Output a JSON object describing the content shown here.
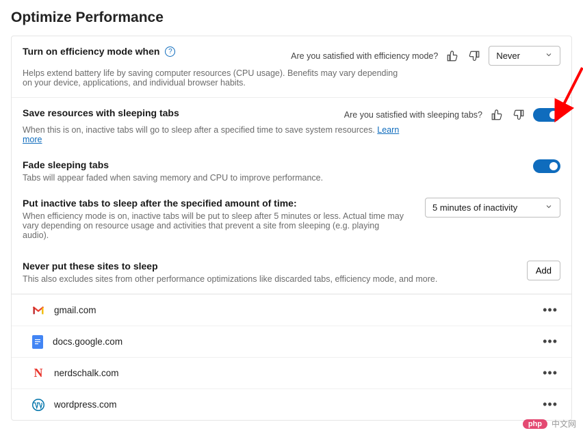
{
  "page_title": "Optimize Performance",
  "efficiency": {
    "title": "Turn on efficiency mode when",
    "desc": "Helps extend battery life by saving computer resources (CPU usage). Benefits may vary depending on your device, applications, and individual browser habits.",
    "feedback_q": "Are you satisfied with efficiency mode?",
    "select_value": "Never"
  },
  "sleeping": {
    "title": "Save resources with sleeping tabs",
    "desc_a": "When this is on, inactive tabs will go to sleep after a specified time to save system resources. ",
    "desc_link": "Learn more",
    "feedback_q": "Are you satisfied with sleeping tabs?",
    "toggle_on": true
  },
  "fade": {
    "title": "Fade sleeping tabs",
    "desc": "Tabs will appear faded when saving memory and CPU to improve performance.",
    "toggle_on": true
  },
  "timer": {
    "title": "Put inactive tabs to sleep after the specified amount of time:",
    "desc": "When efficiency mode is on, inactive tabs will be put to sleep after 5 minutes or less. Actual time may vary depending on resource usage and activities that prevent a site from sleeping (e.g. playing audio).",
    "select_value": "5 minutes of inactivity"
  },
  "never_sleep": {
    "title": "Never put these sites to sleep",
    "desc": "This also excludes sites from other performance optimizations like discarded tabs, efficiency mode, and more.",
    "add_label": "Add",
    "sites": {
      "0": {
        "name": "gmail.com"
      },
      "1": {
        "name": "docs.google.com"
      },
      "2": {
        "name": "nerdschalk.com"
      },
      "3": {
        "name": "wordpress.com"
      }
    }
  },
  "watermark": {
    "pill": "php",
    "text": "中文网"
  }
}
